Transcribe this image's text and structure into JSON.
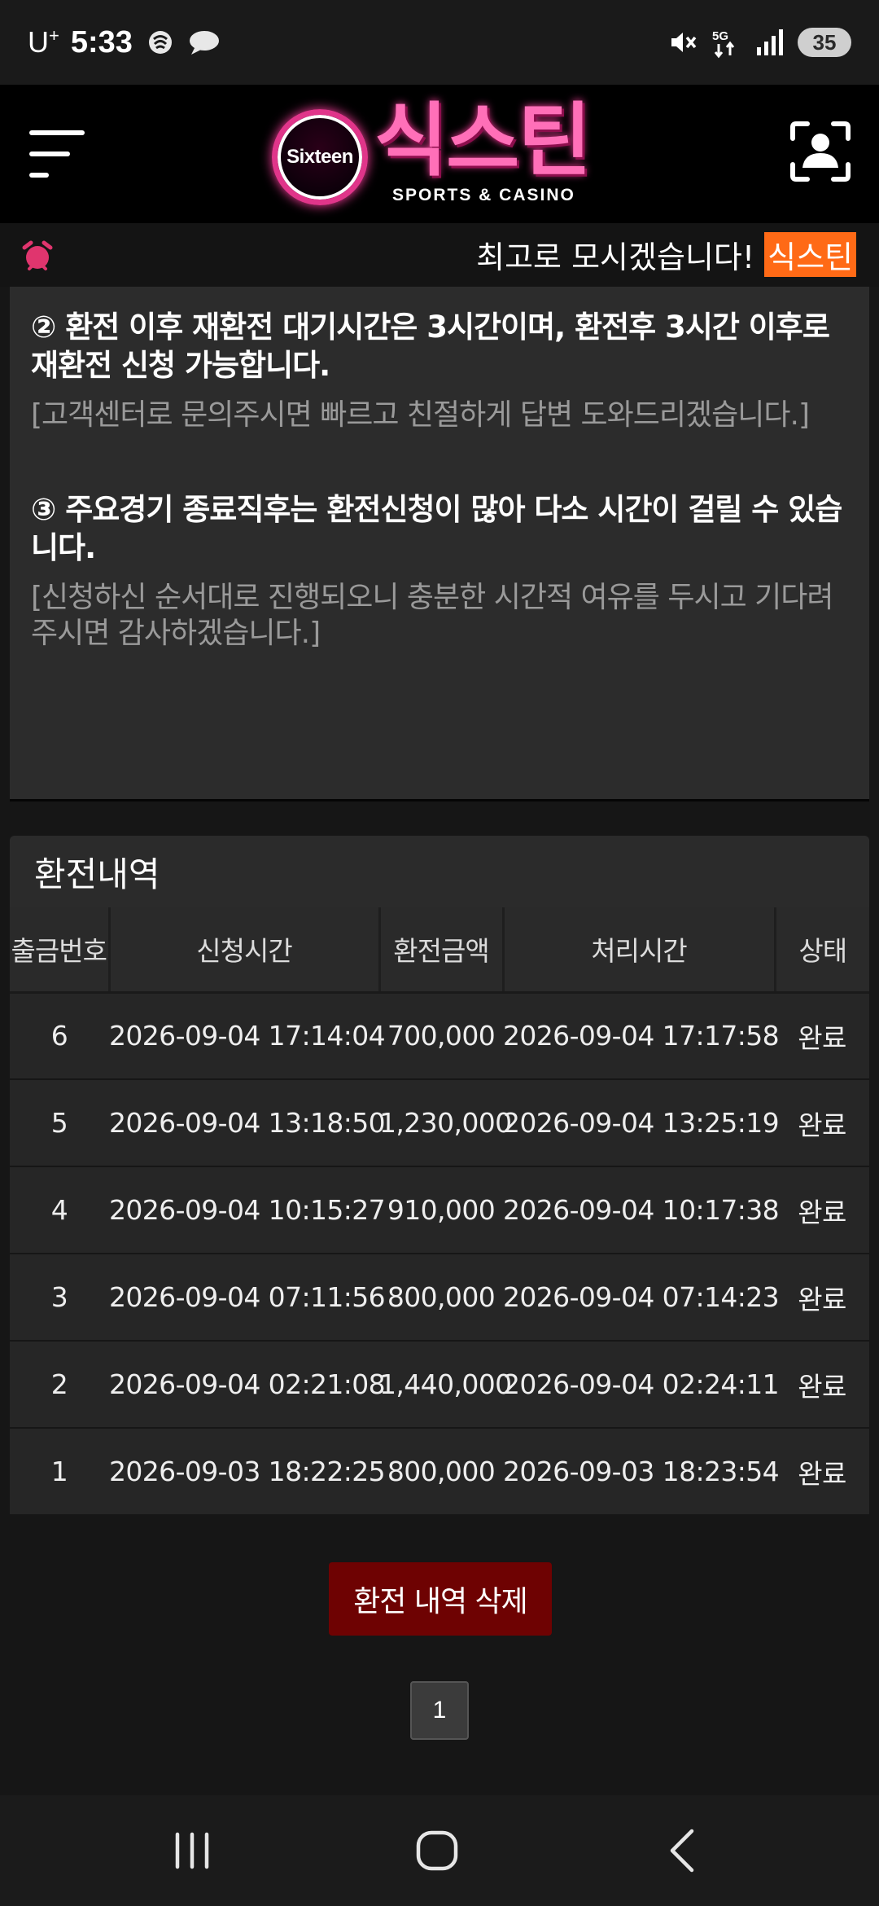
{
  "status_bar": {
    "carrier": "U",
    "carrier_sup": "+",
    "time": "5:33",
    "battery": "35",
    "network": "5G"
  },
  "header": {
    "logo_badge": "Sixteen",
    "logo_title": "식스틴",
    "logo_subtitle": "SPORTS & CASINO",
    "accent_color": "#ff6fb8"
  },
  "ticker": {
    "message": "최고로 모시겠습니다!",
    "highlight": "식스틴",
    "highlight_color": "#ff6a16"
  },
  "notice": {
    "item2_title": "② 환전 이후 재환전 대기시간은 3시간이며, 환전후 3시간 이후로 재환전 신청 가능합니다.",
    "item2_note": "[고객센터로 문의주시면 빠르고 친절하게 답변 도와드리겠습니다.]",
    "item3_title": "③ 주요경기 종료직후는 환전신청이 많아 다소 시간이 걸릴 수 있습니다.",
    "item3_note": "[신청하신 순서대로 진행되오니 충분한 시간적 여유를 두시고 기다려 주시면 감사하겠습니다.]"
  },
  "history": {
    "title": "환전내역",
    "columns": [
      "출금번호",
      "신청시간",
      "환전금액",
      "처리시간",
      "상태"
    ],
    "rows": [
      [
        "6",
        "2026-09-04 17:14:04",
        "700,000",
        "2026-09-04 17:17:58",
        "완료"
      ],
      [
        "5",
        "2026-09-04 13:18:50",
        "1,230,000",
        "2026-09-04 13:25:19",
        "완료"
      ],
      [
        "4",
        "2026-09-04 10:15:27",
        "910,000",
        "2026-09-04 10:17:38",
        "완료"
      ],
      [
        "3",
        "2026-09-04 07:11:56",
        "800,000",
        "2026-09-04 07:14:23",
        "완료"
      ],
      [
        "2",
        "2026-09-04 02:21:08",
        "1,440,000",
        "2026-09-04 02:24:11",
        "완료"
      ],
      [
        "1",
        "2026-09-03 18:22:25",
        "800,000",
        "2026-09-03 18:23:54",
        "완료"
      ]
    ]
  },
  "actions": {
    "delete_label": "환전 내역 삭제",
    "delete_color": "#6e0202"
  },
  "pagination": {
    "current_page": "1"
  },
  "icons": {
    "menu": "hamburger-menu-icon",
    "profile": "user-scan-icon",
    "ticker": "alarm-bell-icon",
    "nav_recents": "recents-icon",
    "nav_home": "home-icon",
    "nav_back": "back-icon"
  }
}
